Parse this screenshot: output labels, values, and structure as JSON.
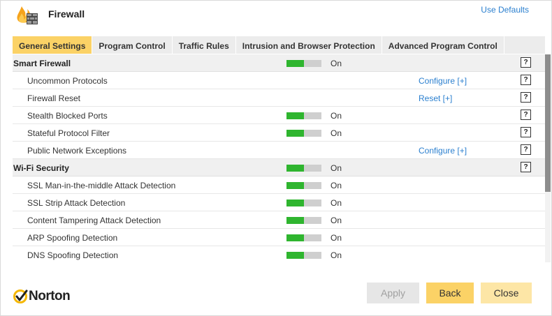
{
  "header": {
    "title": "Firewall",
    "use_defaults": "Use Defaults"
  },
  "tabs": [
    {
      "label": "General Settings",
      "active": true
    },
    {
      "label": "Program Control",
      "active": false
    },
    {
      "label": "Traffic Rules",
      "active": false
    },
    {
      "label": "Intrusion and Browser Protection",
      "active": false
    },
    {
      "label": "Advanced Program Control",
      "active": false
    }
  ],
  "rows": [
    {
      "label": "Smart Firewall",
      "section": true,
      "toggle": true,
      "state": "On",
      "link": "",
      "help": "?"
    },
    {
      "label": "Uncommon Protocols",
      "section": false,
      "toggle": false,
      "state": "",
      "link": "Configure [+]",
      "help": "?"
    },
    {
      "label": "Firewall Reset",
      "section": false,
      "toggle": false,
      "state": "",
      "link": "Reset [+]",
      "help": "?"
    },
    {
      "label": "Stealth Blocked Ports",
      "section": false,
      "toggle": true,
      "state": "On",
      "link": "",
      "help": "?"
    },
    {
      "label": "Stateful Protocol Filter",
      "section": false,
      "toggle": true,
      "state": "On",
      "link": "",
      "help": "?"
    },
    {
      "label": "Public Network Exceptions",
      "section": false,
      "toggle": false,
      "state": "",
      "link": "Configure [+]",
      "help": "?"
    },
    {
      "label": "Wi-Fi Security",
      "section": true,
      "toggle": true,
      "state": "On",
      "link": "",
      "help": "?"
    },
    {
      "label": "SSL Man-in-the-middle Attack Detection",
      "section": false,
      "toggle": true,
      "state": "On",
      "link": "",
      "help": ""
    },
    {
      "label": "SSL Strip Attack Detection",
      "section": false,
      "toggle": true,
      "state": "On",
      "link": "",
      "help": ""
    },
    {
      "label": "Content Tampering Attack Detection",
      "section": false,
      "toggle": true,
      "state": "On",
      "link": "",
      "help": ""
    },
    {
      "label": "ARP Spoofing Detection",
      "section": false,
      "toggle": true,
      "state": "On",
      "link": "",
      "help": ""
    },
    {
      "label": "DNS Spoofing Detection",
      "section": false,
      "toggle": true,
      "state": "On",
      "link": "",
      "help": ""
    }
  ],
  "toggle_on_fraction": 0.5,
  "footer": {
    "brand": "Norton",
    "apply": "Apply",
    "back": "Back",
    "close": "Close"
  },
  "colors": {
    "accent": "#fbd266",
    "toggle_on": "#2fb52f",
    "link": "#2a7fcf",
    "section_bg": "#f0f0f0"
  }
}
